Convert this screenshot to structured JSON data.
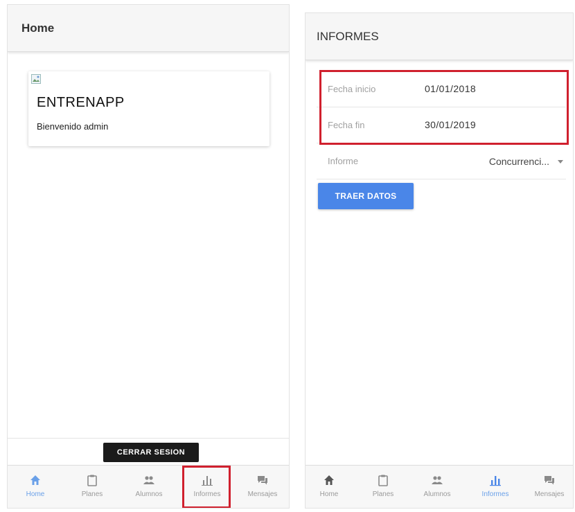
{
  "left_screen": {
    "header": {
      "title": "Home"
    },
    "card": {
      "title": "ENTRENAPP",
      "subtitle": "Bienvenido admin"
    },
    "logout_label": "CERRAR SESION",
    "tabs": [
      {
        "label": "Home",
        "icon": "home-icon"
      },
      {
        "label": "Planes",
        "icon": "clipboard-icon"
      },
      {
        "label": "Alumnos",
        "icon": "people-icon"
      },
      {
        "label": "Informes",
        "icon": "bar-chart-icon"
      },
      {
        "label": "Mensajes",
        "icon": "chat-icon"
      }
    ],
    "active_tab": "Home"
  },
  "right_screen": {
    "header": {
      "title": "INFORMES"
    },
    "form": {
      "fecha_inicio": {
        "label": "Fecha inicio",
        "value": "01/01/2018"
      },
      "fecha_fin": {
        "label": "Fecha fin",
        "value": "30/01/2019"
      },
      "informe": {
        "label": "Informe",
        "value": "Concurrenci..."
      }
    },
    "primary_button": "TRAER DATOS",
    "tabs": [
      {
        "label": "Home",
        "icon": "home-icon"
      },
      {
        "label": "Planes",
        "icon": "clipboard-icon"
      },
      {
        "label": "Alumnos",
        "icon": "people-icon"
      },
      {
        "label": "Informes",
        "icon": "bar-chart-icon"
      },
      {
        "label": "Mensajes",
        "icon": "chat-icon"
      }
    ],
    "active_tab": "Informes"
  },
  "colors": {
    "accent_blue": "#4a86e8",
    "active_tab": "#6aa0e8",
    "highlight_red": "#d0202e",
    "dark_button": "#1b1b1b"
  }
}
